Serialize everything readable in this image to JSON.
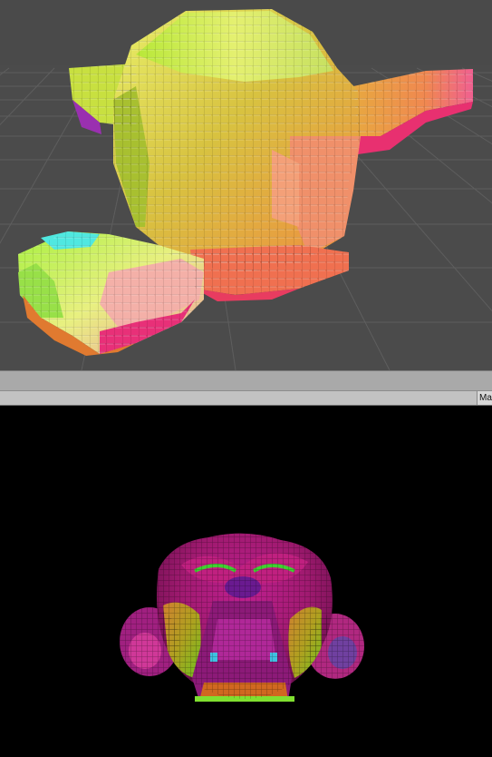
{
  "game_view": {
    "toolbar_button_label": "Ma"
  },
  "colors": {
    "scene_background": "#4a4a4a",
    "grid_line": "#5c5c5c",
    "splitter": "#a9a9a9",
    "toolbar": "#c2c2c2",
    "game_background": "#000000"
  }
}
